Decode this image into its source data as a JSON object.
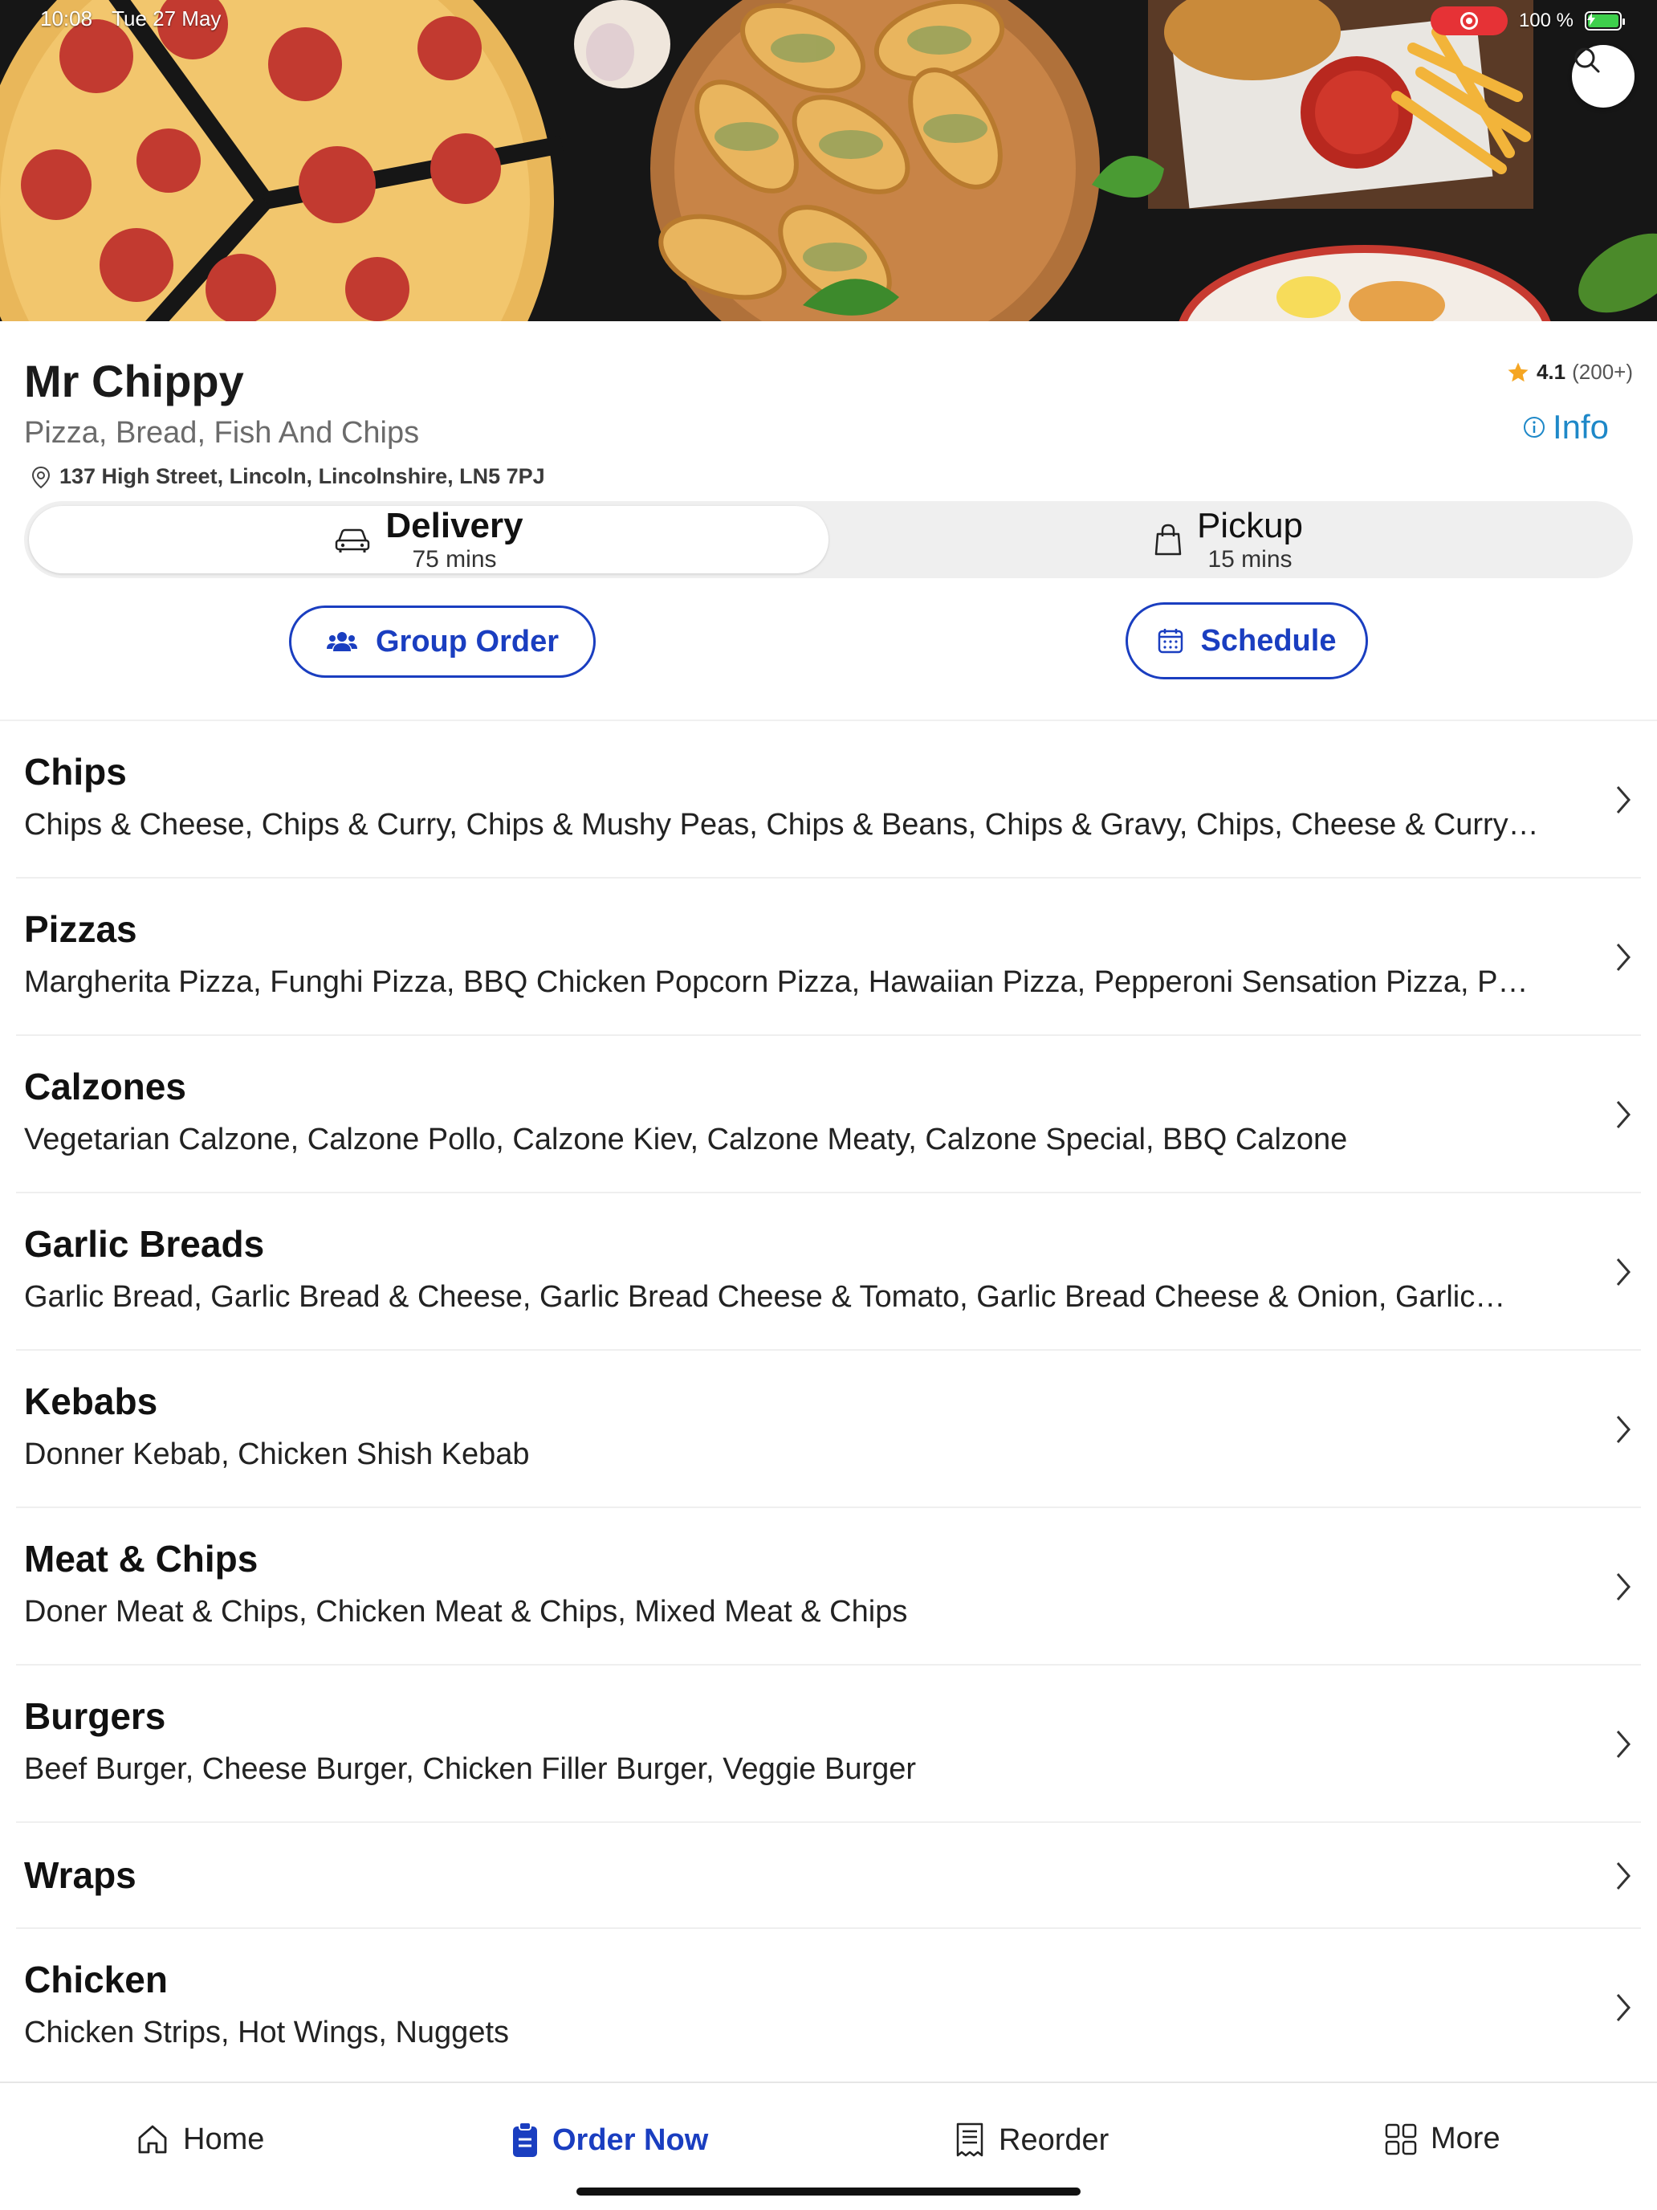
{
  "status_bar": {
    "time": "10:08",
    "date": "Tue 27 May",
    "battery": "100 %"
  },
  "restaurant": {
    "name": "Mr  Chippy",
    "cuisine": "Pizza, Bread, Fish And Chips",
    "address": "137 High Street, Lincoln, Lincolnshire, LN5 7PJ",
    "rating": "4.1",
    "rating_count": "(200+)",
    "info_label": "Info"
  },
  "modes": {
    "delivery": {
      "label": "Delivery",
      "time": "75 mins",
      "selected": true
    },
    "pickup": {
      "label": "Pickup",
      "time": "15 mins",
      "selected": false
    }
  },
  "actions": {
    "group_order": "Group Order",
    "schedule": "Schedule"
  },
  "categories": [
    {
      "title": "Chips",
      "items": "Chips & Cheese, Chips & Curry, Chips & Mushy Peas, Chips & Beans, Chips & Gravy, Chips, Cheese & Curry…"
    },
    {
      "title": "Pizzas",
      "items": "Margherita Pizza, Funghi Pizza, BBQ Chicken Popcorn Pizza, Hawaiian Pizza, Pepperoni Sensation Pizza, P…"
    },
    {
      "title": "Calzones",
      "items": "Vegetarian Calzone, Calzone Pollo, Calzone Kiev, Calzone Meaty, Calzone Special, BBQ Calzone"
    },
    {
      "title": "Garlic Breads",
      "items": "Garlic Bread, Garlic Bread & Cheese, Garlic Bread Cheese & Tomato, Garlic Bread Cheese & Onion, Garlic…"
    },
    {
      "title": "Kebabs",
      "items": "Donner Kebab, Chicken Shish Kebab"
    },
    {
      "title": "Meat & Chips",
      "items": "Doner Meat & Chips, Chicken Meat & Chips, Mixed Meat & Chips"
    },
    {
      "title": "Burgers",
      "items": "Beef Burger, Cheese Burger, Chicken Filler Burger, Veggie Burger"
    },
    {
      "title": "Wraps",
      "items": ""
    },
    {
      "title": "Chicken",
      "items": "Chicken Strips, Hot Wings, Nuggets"
    }
  ],
  "bottom_nav": {
    "home": "Home",
    "order_now": "Order Now",
    "reorder": "Reorder",
    "more": "More",
    "active": "order_now"
  },
  "colors": {
    "accent_blue": "#1a3ec0",
    "info_blue": "#1e88c8",
    "star": "#f5a623",
    "record_red": "#e63236"
  },
  "icons": {
    "search": "search-icon",
    "star": "star-icon",
    "info": "info-icon",
    "location": "location-pin-icon",
    "delivery": "car-icon",
    "pickup": "bag-icon",
    "group": "group-icon",
    "schedule": "calendar-icon",
    "chevron": "chevron-right-icon",
    "home": "home-icon",
    "order": "order-icon",
    "reorder": "receipt-icon",
    "more": "grid-icon"
  }
}
